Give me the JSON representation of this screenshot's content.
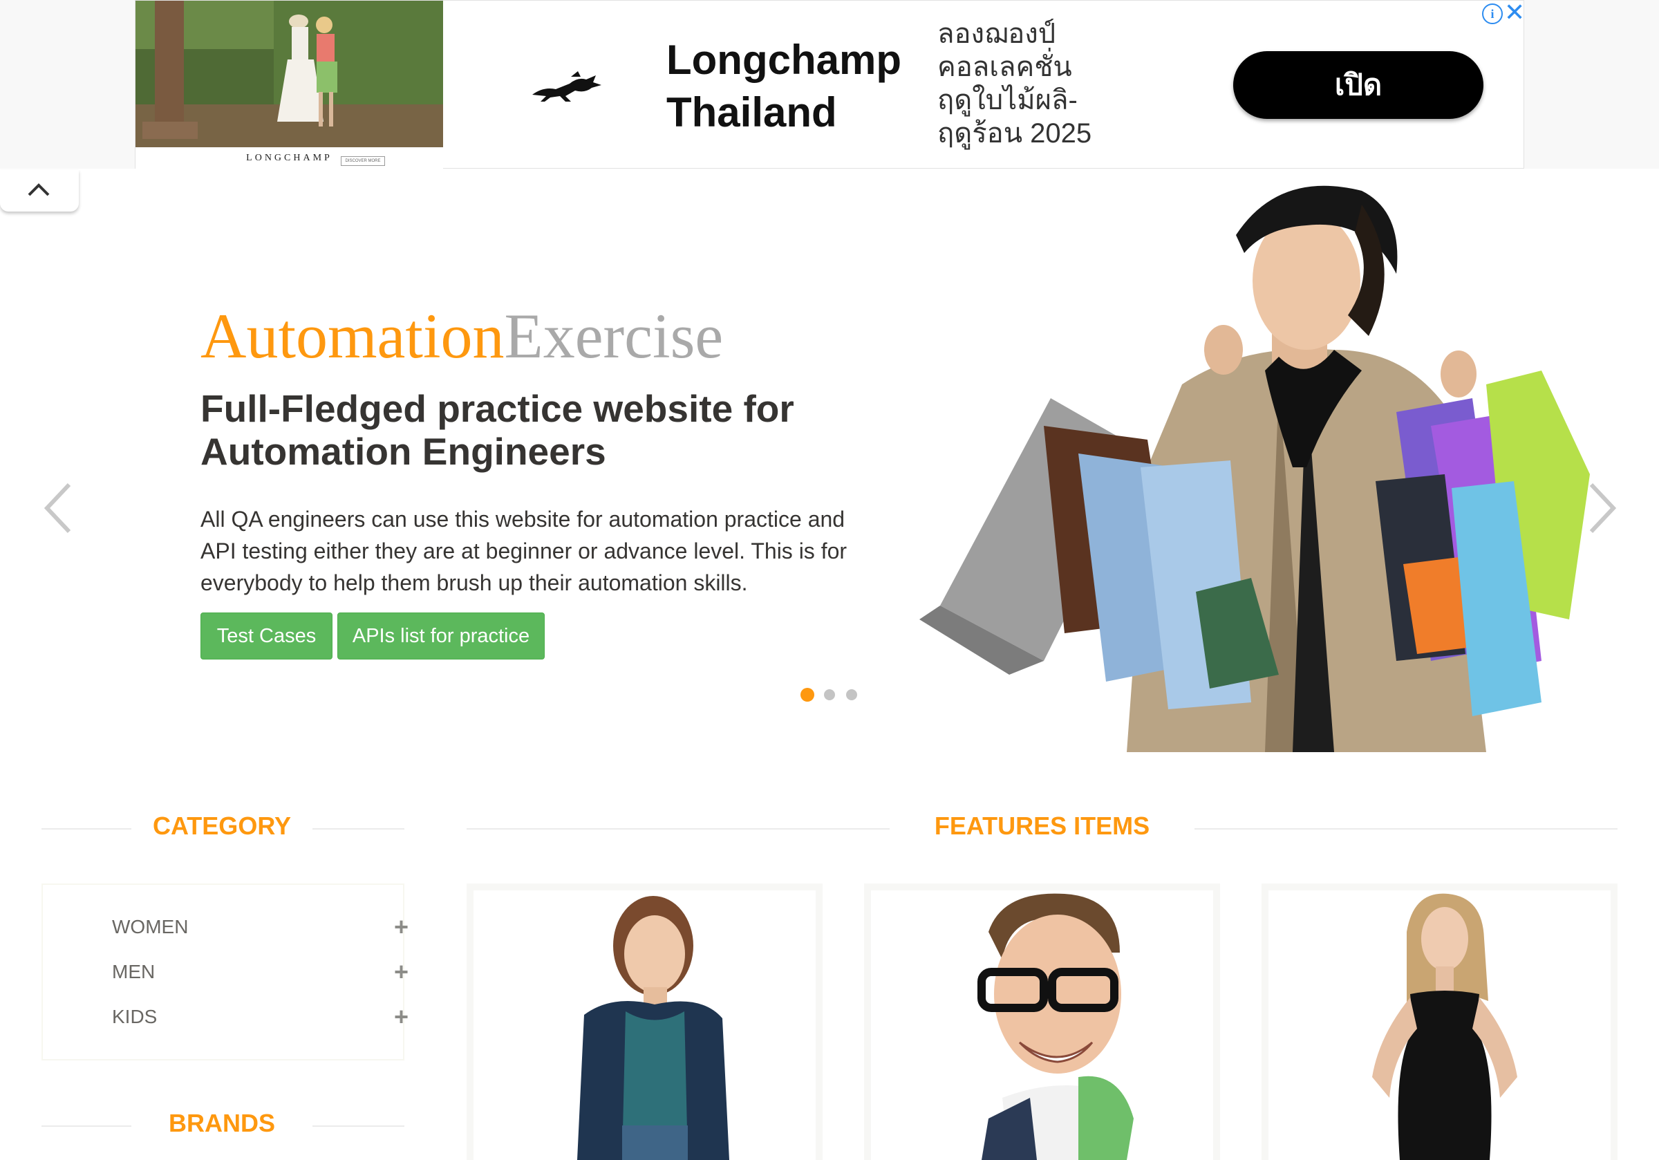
{
  "ad": {
    "brand": "Longchamp Thailand",
    "brand_line1": "Longchamp",
    "brand_line2": "Thailand",
    "copy_lines": [
      "ลองฌองป์",
      "คอลเลคชั่น",
      "ฤดูใบไม้ผลิ-",
      "ฤดูร้อน 2025"
    ],
    "cta_label": "เปิด",
    "photo_wordmark": "LONGCHAMP",
    "photo_discover": "DISCOVER MORE",
    "info_symbol": "i",
    "close_symbol": "✕"
  },
  "slider": {
    "title_part1": "Automation",
    "title_part2": "Exercise",
    "heading": "Full-Fledged practice website for Automation Engineers",
    "description": "All QA engineers can use this website for automation practice and API testing either they are at beginner or advance level. This is for everybody to help them brush up their automation skills.",
    "buttons": {
      "test_cases": "Test Cases",
      "apis_list": "APIs list for practice"
    },
    "active_slide": 1,
    "slide_count": 3
  },
  "sidebar": {
    "category_title": "CATEGORY",
    "categories": [
      {
        "label": "WOMEN",
        "toggle": "+"
      },
      {
        "label": "MEN",
        "toggle": "+"
      },
      {
        "label": "KIDS",
        "toggle": "+"
      }
    ],
    "brands_title": "BRANDS"
  },
  "main": {
    "features_title": "FEATURES ITEMS"
  },
  "colors": {
    "accent": "#fe980f",
    "title_gray": "#a9a9a9",
    "button_green": "#5cb85c",
    "ad_cta": "#000000",
    "ad_info": "#2d8cf0"
  },
  "icons": {
    "collapse": "chevron-up-icon",
    "prev": "chevron-left-icon",
    "next": "chevron-right-icon",
    "ad_logo": "horse-rider-icon",
    "ad_info": "info-icon",
    "ad_close": "close-icon"
  }
}
